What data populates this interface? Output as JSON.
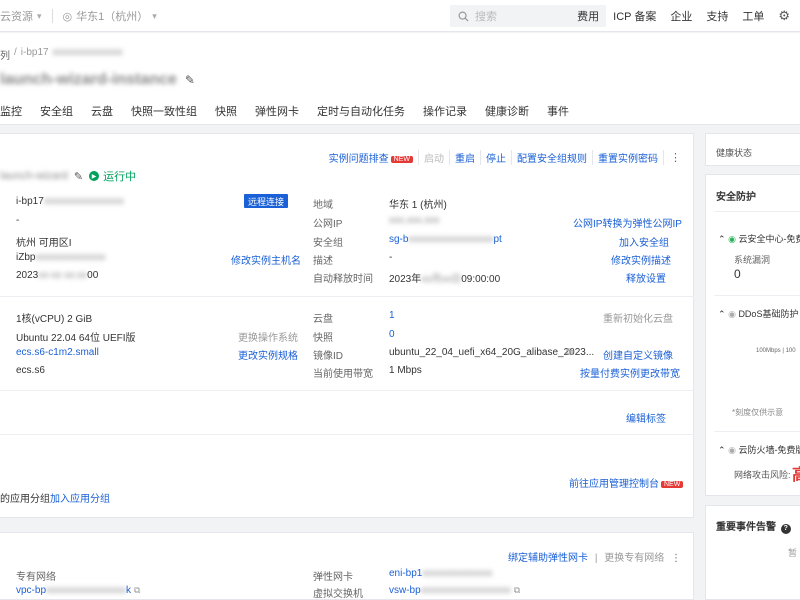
{
  "topbar": {
    "resource_label": "云资源",
    "region_label": "华东1（杭州）",
    "search_placeholder": "搜索",
    "links": [
      "费用",
      "ICP 备案",
      "企业",
      "支持",
      "工单"
    ]
  },
  "header": {
    "breadcrumb_parent": "列",
    "breadcrumb_sep": "/",
    "breadcrumb_current": "i-bp17",
    "breadcrumb_current_masked": "xxxxxxxxxxxxxx",
    "title_masked": "launch-wizard-instance"
  },
  "tabs": [
    "监控",
    "安全组",
    "云盘",
    "快照一致性组",
    "快照",
    "弹性网卡",
    "定时与自动化任务",
    "操作记录",
    "健康诊断",
    "事件"
  ],
  "instance": {
    "name_masked": "launch-wizard",
    "state": "运行中",
    "actions": [
      {
        "label": "实例问题排查",
        "badge": "NEW",
        "enabled": true
      },
      {
        "label": "启动",
        "enabled": false
      },
      {
        "label": "重启",
        "enabled": true
      },
      {
        "label": "停止",
        "enabled": true
      },
      {
        "label": "配置安全组规则",
        "enabled": true
      },
      {
        "label": "重置实例密码",
        "enabled": true
      }
    ],
    "more_icon": "⋮"
  },
  "basic": {
    "id_prefix": "i-bp17",
    "id_masked": "xxxxxxxxxxxxxxxx",
    "connect_button": "远程连接",
    "dash": "-",
    "zone": "杭州 可用区I",
    "hostname_prefix": "iZbp",
    "hostname_masked": "xxxxxxxxxxxxxx",
    "edit_hostname": "修改实例主机名",
    "created_prefix": "2023",
    "created_masked": "xx-xx xx:xx",
    "created_suffix": "00",
    "region_label": "地域",
    "region_value": "华东 1 (杭州)",
    "public_ip_label": "公网IP",
    "public_ip_masked": "xxx.xxx.xxx",
    "public_ip_action": "公网IP转换为弹性公网IP",
    "sg_label": "安全组",
    "sg_prefix": "sg-b",
    "sg_masked": "xxxxxxxxxxxxxxxxx",
    "sg_suffix": "pt",
    "sg_action": "加入安全组",
    "desc_label": "描述",
    "desc_value": "-",
    "desc_action": "修改实例描述",
    "release_label": "自动释放时间",
    "release_prefix": "2023年",
    "release_masked": "xx月xx日",
    "release_suffix": "09:00:00",
    "release_action": "释放设置"
  },
  "config": {
    "cpu_mem": "1核(vCPU)  2 GiB",
    "os": "Ubuntu 22.04 64位 UEFI版",
    "change_os": "更换操作系统",
    "instance_type": "ecs.s6-c1m2.small",
    "change_type": "更改实例规格",
    "family": "ecs.s6",
    "disk_label": "云盘",
    "disk_value": "1",
    "disk_action": "重新初始化云盘",
    "snapshot_label": "快照",
    "snapshot_value": "0",
    "image_label": "镜像ID",
    "image_value": "ubuntu_22_04_uefi_x64_20G_alibase_2023...",
    "image_action": "创建自定义镜像",
    "bandwidth_label": "当前使用带宽",
    "bandwidth_value": "1 Mbps",
    "bandwidth_action": "按量付费实例更改带宽"
  },
  "tags": {
    "edit": "编辑标签"
  },
  "app": {
    "goto": "前往应用管理控制台",
    "badge": "NEW",
    "group_label": "的应用分组",
    "add_group": "加入应用分组"
  },
  "network": {
    "bind_eni": "绑定辅助弹性网卡",
    "change_vpc": "更换专有网络",
    "more_icon": "⋮",
    "vpc_label": "专有网络",
    "vpc_prefix": "vpc-bp",
    "vpc_masked": "xxxxxxxxxxxxxxxx",
    "vpc_suffix": "k",
    "eni_label": "弹性网卡",
    "eni_prefix": "eni-bp1",
    "eni_masked": "xxxxxxxxxxxxxx",
    "vsw_label": "虚拟交换机",
    "vsw_prefix": "vsw-bp",
    "vsw_masked": "xxxxxxxxxxxxxxxxxx"
  },
  "side": {
    "health": "健康状态",
    "security": "安全防护",
    "sc_title": "云安全中心-免费",
    "sc_vuln_label": "系统漏洞",
    "sc_vuln_value": "0",
    "ddos_title": "DDoS基础防护",
    "ddos_axis": "100Mbps | 100",
    "ddos_note": "*刻度仅供示意",
    "fw_title": "云防火墙-免费版",
    "fw_risk_label": "网络攻击风险:",
    "fw_risk_value": "高",
    "events_title": "重要事件告警",
    "events_info_icon": "?",
    "events_cut": "暂"
  }
}
